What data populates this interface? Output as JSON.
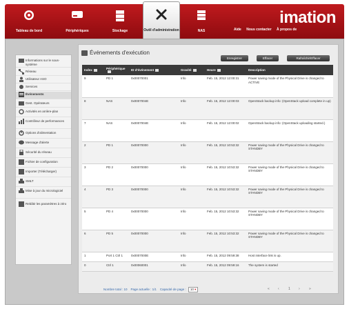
{
  "nav": {
    "items": [
      {
        "label": "Tableau de bord",
        "icon": "dashboard-icon"
      },
      {
        "label": "Périphériques",
        "icon": "devices-icon"
      },
      {
        "label": "Stockage",
        "icon": "storage-icon"
      },
      {
        "label": "Outil d'administration",
        "icon": "tools-icon"
      },
      {
        "label": "NAS",
        "icon": "nas-icon"
      }
    ],
    "active_index": 3,
    "links": [
      "Aide",
      "Nous contacter",
      "À propos de"
    ],
    "brand": "imation",
    "accent": "#c01a1e"
  },
  "sidebar": {
    "items": [
      {
        "label": "Informations sur le sous-système"
      },
      {
        "label": "Réseau"
      },
      {
        "label": "Utilisateur ASO"
      },
      {
        "label": "Services"
      },
      {
        "label": "Événements"
      },
      {
        "label": "Gest. Opérateurs"
      },
      {
        "label": "Activités en arrière-plan"
      },
      {
        "label": "Contrôleur de performances"
      },
      {
        "label": "Options d'alimentation"
      },
      {
        "label": "Message d'alerte"
      },
      {
        "label": "Sécurité du réseau"
      },
      {
        "label": "Fichier de configuration"
      },
      {
        "label": "Importer (Télécharger)"
      },
      {
        "label": "SMLT"
      },
      {
        "label": "Mise à jour du micrologiciel"
      },
      {
        "label": "Rebâtir les paramètres à zéro"
      }
    ],
    "selected_index": 4
  },
  "panel": {
    "title": "Événements d'exécution",
    "buttons": [
      "Enregistrer",
      "Effacer",
      "Rafraîchir/Effacer"
    ]
  },
  "table": {
    "headers": [
      "Index",
      "Périphérique",
      "ID d'événement",
      "Gravité",
      "Heure",
      "Description"
    ],
    "rows": [
      {
        "index": "9",
        "device": "PD 1",
        "event_id": "0x00070001",
        "severity": "Info",
        "time": "Feb. 15, 2012 12:00:31",
        "desc": "Power saving mode of the Physical Drive is changed to ACTIVE"
      },
      {
        "index": "8",
        "device": "NAS",
        "event_id": "0x0007004E",
        "severity": "Info",
        "time": "Feb. 15, 2012 12:00:03",
        "desc": "OpenStack backup info: (OpenStack upload complete in up)"
      },
      {
        "index": "7",
        "device": "NAS",
        "event_id": "0x0007004E",
        "severity": "Info",
        "time": "Feb. 15, 2012 12:00:02",
        "desc": "OpenStack backup info: (OpenStack uploading started.)"
      },
      {
        "index": "2",
        "device": "PD 1",
        "event_id": "0x00070000",
        "severity": "Info",
        "time": "Feb. 15, 2012 10:53:32",
        "desc": "Power saving mode of the Physical Drive is changed to STANDBY"
      },
      {
        "index": "3",
        "device": "PD 2",
        "event_id": "0x00070000",
        "severity": "Info",
        "time": "Feb. 15, 2012 10:53:32",
        "desc": "Power saving mode of the Physical Drive is changed to STANDBY"
      },
      {
        "index": "4",
        "device": "PD 3",
        "event_id": "0x00070000",
        "severity": "Info",
        "time": "Feb. 15, 2012 10:53:32",
        "desc": "Power saving mode of the Physical Drive is changed to STANDBY"
      },
      {
        "index": "5",
        "device": "PD 4",
        "event_id": "0x00070000",
        "severity": "Info",
        "time": "Feb. 15, 2012 10:53:32",
        "desc": "Power saving mode of the Physical Drive is changed to STANDBY"
      },
      {
        "index": "6",
        "device": "PD 5",
        "event_id": "0x00070000",
        "severity": "Info",
        "time": "Feb. 15, 2012 10:53:32",
        "desc": "Power saving mode of the Physical Drive is changed to STANDBY"
      },
      {
        "index": "1",
        "device": "Port 1 Ctrl 1",
        "event_id": "0x0007000E",
        "severity": "Info",
        "time": "Feb. 15, 2012 09:59:38",
        "desc": "Host interface link is up."
      },
      {
        "index": "0",
        "device": "Ctrl 1",
        "event_id": "0x00060001",
        "severity": "Info",
        "time": "Feb. 15, 2012 09:59:16",
        "desc": "The system is started"
      }
    ]
  },
  "footer": {
    "total": "Nombre total : 10",
    "page": "Page actuelle : 1/1",
    "per_page_label": "Capacité de page :",
    "per_page_value": "10",
    "pager": [
      "«",
      "‹",
      "1",
      "›",
      "»"
    ]
  }
}
